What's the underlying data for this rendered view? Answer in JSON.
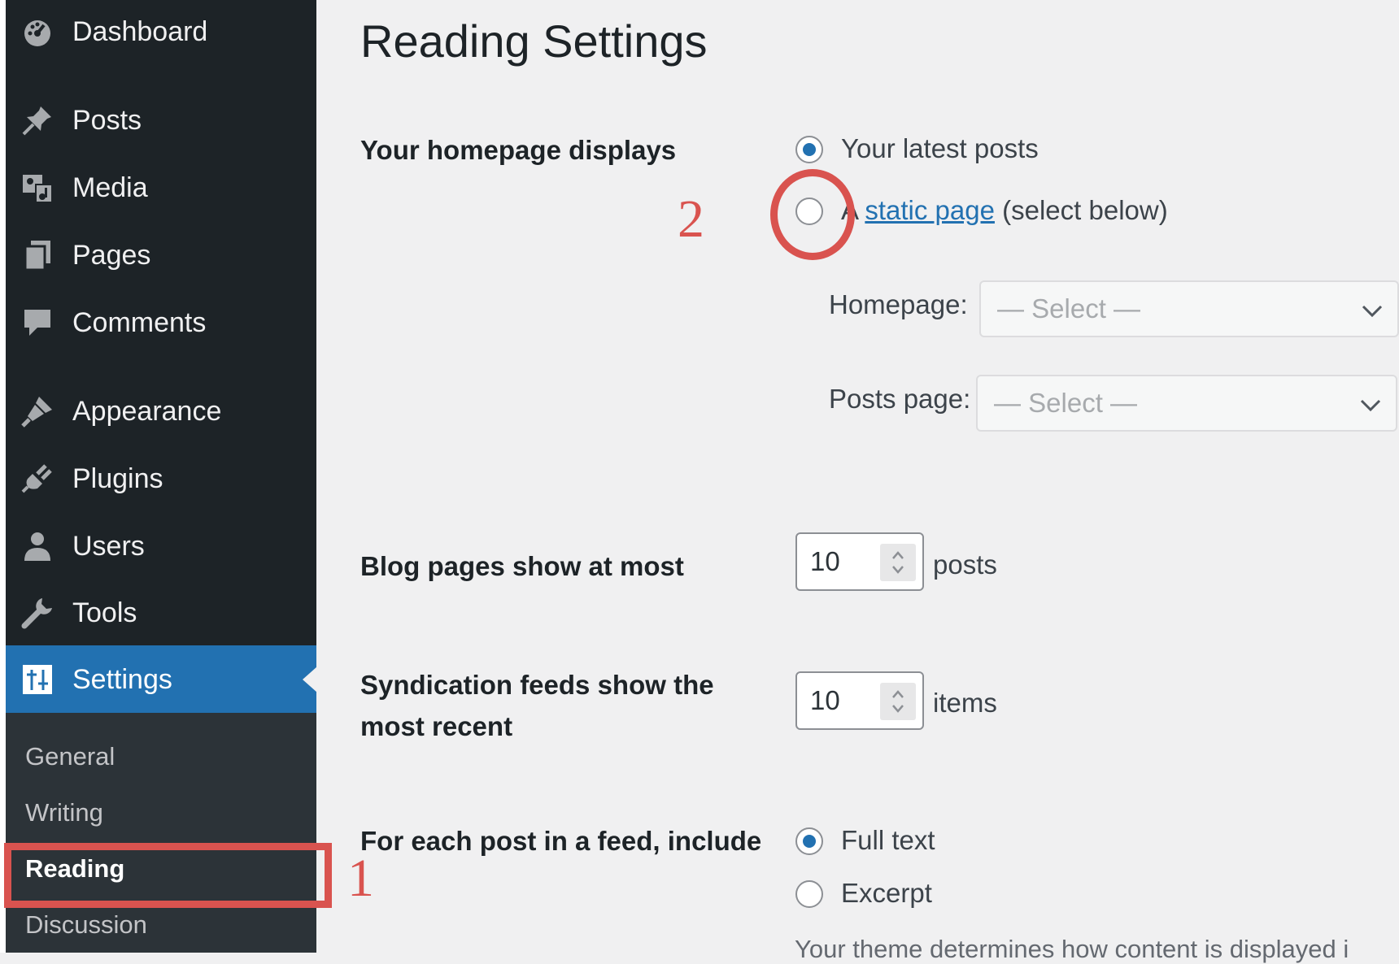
{
  "sidebar": {
    "items": [
      {
        "label": "Dashboard",
        "icon": "dashboard-icon"
      },
      {
        "label": "Posts",
        "icon": "pin-icon"
      },
      {
        "label": "Media",
        "icon": "media-icon"
      },
      {
        "label": "Pages",
        "icon": "pages-icon"
      },
      {
        "label": "Comments",
        "icon": "comment-icon"
      },
      {
        "label": "Appearance",
        "icon": "brush-icon"
      },
      {
        "label": "Plugins",
        "icon": "plugin-icon"
      },
      {
        "label": "Users",
        "icon": "user-icon"
      },
      {
        "label": "Tools",
        "icon": "wrench-icon"
      },
      {
        "label": "Settings",
        "icon": "settings-icon"
      }
    ],
    "submenu": [
      "General",
      "Writing",
      "Reading",
      "Discussion"
    ]
  },
  "page": {
    "title": "Reading Settings",
    "homepage": {
      "label": "Your homepage displays",
      "option_latest": "Your latest posts",
      "option_static_prefix": "A ",
      "option_static_link": "static page",
      "option_static_suffix": " (select below)",
      "selected": "latest",
      "homepage_label": "Homepage:",
      "homepage_value": "— Select —",
      "posts_page_label": "Posts page:",
      "posts_page_value": "— Select —"
    },
    "blog_pages": {
      "label": "Blog pages show at most",
      "value": "10",
      "unit": "posts"
    },
    "syndication": {
      "label_line1": "Syndication feeds show the",
      "label_line2": "most recent",
      "value": "10",
      "unit": "items"
    },
    "feed_include": {
      "label": "For each post in a feed, include",
      "option_full": "Full text",
      "option_excerpt": "Excerpt",
      "selected": "full",
      "description": "Your theme determines how content is displayed i"
    }
  },
  "annotations": {
    "step1": "1",
    "step2": "2",
    "color": "#d9534f"
  },
  "colors": {
    "accent": "#2271b1",
    "sidebar": "#1d2327",
    "annotation": "#d9534f"
  }
}
